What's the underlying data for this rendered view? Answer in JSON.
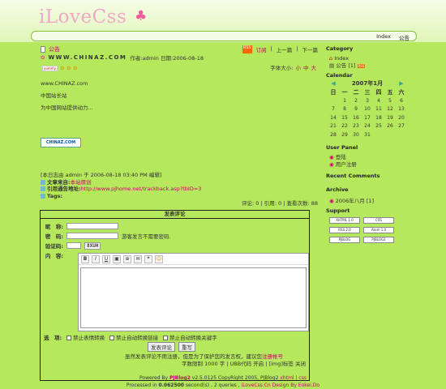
{
  "header": {
    "logo": "iLoveCss",
    "logo_icon": "clover-icon",
    "nav": [
      "Index",
      "公告"
    ]
  },
  "post": {
    "title": "公告",
    "site_url": "WWW.CHINAZ.COM",
    "author_line": "作者:admin 日期:2006-08-18",
    "subscribe": "订阅",
    "prev": "上一篇",
    "next": "下一篇",
    "font_label": "字体大小:",
    "font_sizes": [
      "小",
      "中",
      "大"
    ],
    "mood": "yummy",
    "content_url": "www.CHINAZ.com",
    "line1": "中国站长站",
    "line2": "为中国网站提供动力...",
    "banner": "CHINAZ.COM",
    "edit_note": "[本日志由 admin 于 2006-08-18 03:40 PM 编辑]",
    "source_label": "文章来自:",
    "source_val": "本站原创",
    "trackback_label": "引用通告地址:",
    "trackback_val": "http://www.pjhome.net/trackback.asp?tbID=3",
    "tags_label": "Tags:",
    "stats": "评论: 0 | 引用: 0 | 查看次数: 88"
  },
  "form": {
    "heading": "发表评论",
    "nick_label": "昵　称:",
    "pwd_label": "密　码:",
    "pwd_hint": "游客发言不需要密码.",
    "captcha_label": "验证码:",
    "captcha_val": "8XUH",
    "content_label": "内　容:",
    "options_label": "选　项:",
    "opt1": "禁止表情转换",
    "opt2": "禁止自动转换链接",
    "opt3": "禁止自动转换关键字",
    "submit": "发表评论",
    "reset": "重写",
    "note_pre": "虽然发表评论不用注册，但是为了保护您的发言权，建议您",
    "note_link": "注册帐号",
    "limit": "字数限制 1000 字 | UBB代码 开启 | [img]标签 关闭"
  },
  "sidebar": {
    "category_h": "Category",
    "cat_index": "Index",
    "cat_notice": "公告",
    "cat_count": "[1]",
    "calendar_h": "Calendar",
    "cal_title": "2007年1月",
    "weekdays": [
      "日",
      "一",
      "二",
      "三",
      "四",
      "五",
      "六"
    ],
    "weeks": [
      [
        "",
        "1",
        "2",
        "3",
        "4",
        "5",
        "6"
      ],
      [
        "7",
        "8",
        "9",
        "10",
        "11",
        "12",
        "13"
      ],
      [
        "14",
        "15",
        "16",
        "17",
        "18",
        "19",
        "20"
      ],
      [
        "21",
        "22",
        "23",
        "24",
        "25",
        "26",
        "27"
      ],
      [
        "28",
        "29",
        "30",
        "31",
        "",
        "",
        ""
      ]
    ],
    "user_h": "User Panel",
    "login": "登陆",
    "register": "用户注册",
    "recent_h": "Recent Comments",
    "archive_h": "Archive",
    "archive_item": "2006年八月",
    "archive_count": "[1]",
    "support_h": "Support",
    "badges": [
      "XHTML 1.0",
      "CSS",
      "RSS 2.0",
      "Atom 1.0",
      "PJBLOG",
      "PJBLOG2",
      "ILOVECSS",
      "CSS"
    ]
  },
  "footer": {
    "line1_pre": "Powered By ",
    "line1_brand": "PJBlog2",
    "line1_mid": " v2.5.0125 CopyRight 2005, PJBlog2 ",
    "line1_links": "xhtml | css",
    "line2_pre": "Processed in ",
    "line2_time": "0.062500",
    "line2_rest": " second(s) , 2 queries , ",
    "line2_design": "iLoveCss.Cn Design By Eokei.Do"
  },
  "colors": {
    "bg": "#b5e85c",
    "accent": "#cc0066"
  }
}
